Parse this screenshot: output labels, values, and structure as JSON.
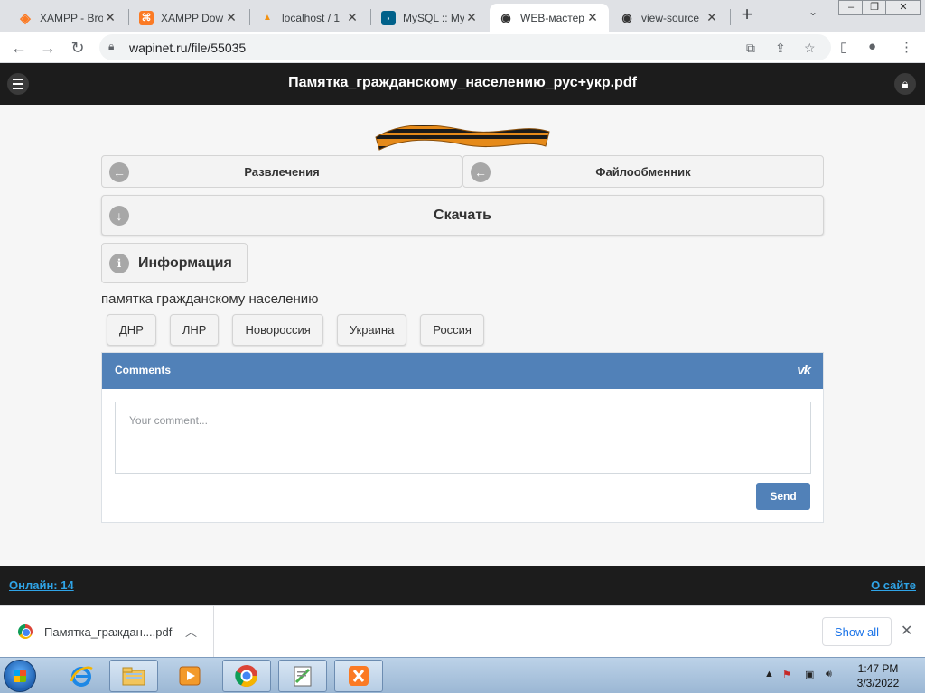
{
  "browser": {
    "tabs": [
      {
        "title": "XAMPP - Bro",
        "icon": "xampp-orange-icon"
      },
      {
        "title": "XAMPP Dow",
        "icon": "xampp-icon"
      },
      {
        "title": "localhost / 1",
        "icon": "phpmyadmin-icon"
      },
      {
        "title": "MySQL :: My",
        "icon": "mysql-icon"
      },
      {
        "title": "WEB-мастер",
        "icon": "eye-icon"
      },
      {
        "title": "view-source",
        "icon": "eye-icon"
      }
    ],
    "url": "wapinet.ru/file/55035"
  },
  "site": {
    "title": "Памятка_гражданскому_населению_рус+укр.pdf",
    "nav_left": "Развлечения",
    "nav_right": "Файлообменник",
    "download": "Скачать",
    "info": "Информация",
    "description": "памятка гражданскому населению",
    "tags": [
      "ДНР",
      "ЛНР",
      "Новороссия",
      "Украина",
      "Россия"
    ]
  },
  "comments": {
    "title": "Comments",
    "placeholder": "Your comment...",
    "send": "Send"
  },
  "footer": {
    "online": "Онлайн: 14",
    "about": "О сайте"
  },
  "downloads": {
    "file": "Памятка_граждан....pdf",
    "show_all": "Show all"
  },
  "clock": {
    "time": "1:47 PM",
    "date": "3/3/2022"
  }
}
